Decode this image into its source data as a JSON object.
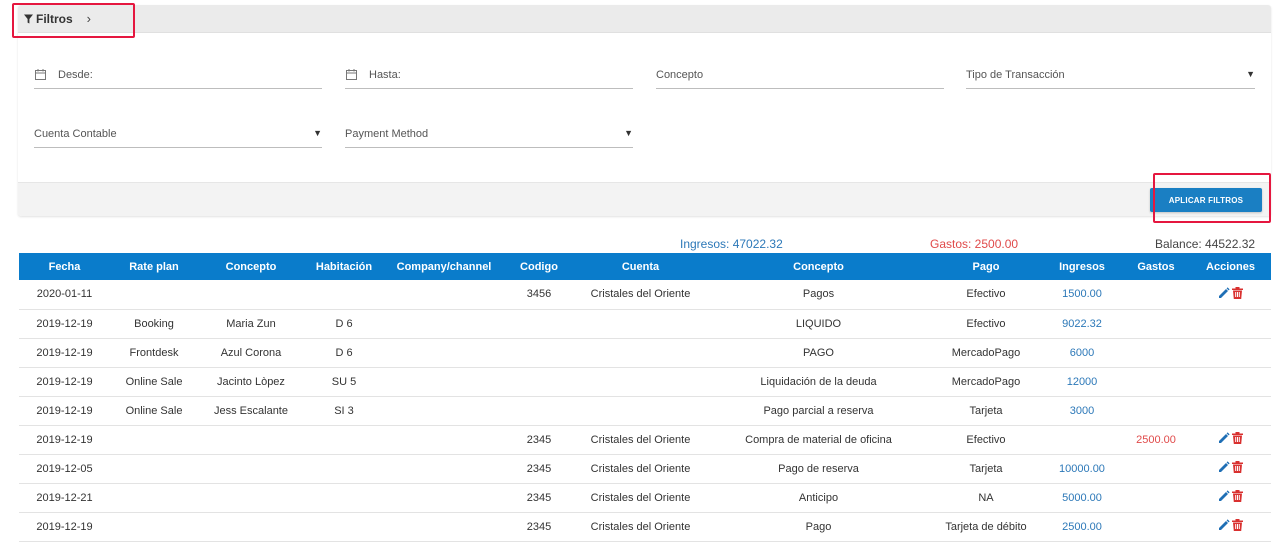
{
  "filters": {
    "title": "Filtros",
    "desde_label": "Desde:",
    "hasta_label": "Hasta:",
    "concepto_label": "Concepto",
    "tipo_transaccion_label": "Tipo de Transacción",
    "cuenta_contable_label": "Cuenta Contable",
    "payment_method_label": "Payment Method",
    "apply_button": "APLICAR FILTROS"
  },
  "totals": {
    "ingresos": "Ingresos: 47022.32",
    "gastos": "Gastos: 2500.00",
    "balance": "Balance: 44522.32"
  },
  "colors": {
    "header_blue": "#0a7ccb",
    "ingresos_blue": "#2c78b8",
    "gastos_red": "#e04a4a",
    "highlight_red": "#e5173f"
  },
  "table": {
    "columns": [
      "Fecha",
      "Rate plan",
      "Concepto",
      "Habitación",
      "Company/channel",
      "Codigo",
      "Cuenta",
      "Concepto",
      "Pago",
      "Ingresos",
      "Gastos",
      "Acciones"
    ],
    "rows": [
      {
        "fecha": "2020-01-11",
        "rate_plan": "",
        "concepto1": "",
        "habitacion": "",
        "company": "",
        "codigo": "3456",
        "cuenta": "Cristales del Oriente",
        "concepto2": "Pagos",
        "pago": "Efectivo",
        "ingresos": "1500.00",
        "gastos": "",
        "acciones": true
      },
      {
        "fecha": "2019-12-19",
        "rate_plan": "Booking",
        "concepto1": "Maria Zun",
        "habitacion": "D 6",
        "company": "",
        "codigo": "",
        "cuenta": "",
        "concepto2": "LIQUIDO",
        "pago": "Efectivo",
        "ingresos": "9022.32",
        "gastos": "",
        "acciones": false
      },
      {
        "fecha": "2019-12-19",
        "rate_plan": "Frontdesk",
        "concepto1": "Azul Corona",
        "habitacion": "D 6",
        "company": "",
        "codigo": "",
        "cuenta": "",
        "concepto2": "PAGO",
        "pago": "MercadoPago",
        "ingresos": "6000",
        "gastos": "",
        "acciones": false
      },
      {
        "fecha": "2019-12-19",
        "rate_plan": "Online Sale",
        "concepto1": "Jacinto Lòpez",
        "habitacion": "SU 5",
        "company": "",
        "codigo": "",
        "cuenta": "",
        "concepto2": "Liquidación de la deuda",
        "pago": "MercadoPago",
        "ingresos": "12000",
        "gastos": "",
        "acciones": false
      },
      {
        "fecha": "2019-12-19",
        "rate_plan": "Online Sale",
        "concepto1": "Jess Escalante",
        "habitacion": "SI 3",
        "company": "",
        "codigo": "",
        "cuenta": "",
        "concepto2": "Pago parcial a reserva",
        "pago": "Tarjeta",
        "ingresos": "3000",
        "gastos": "",
        "acciones": false
      },
      {
        "fecha": "2019-12-19",
        "rate_plan": "",
        "concepto1": "",
        "habitacion": "",
        "company": "",
        "codigo": "2345",
        "cuenta": "Cristales del Oriente",
        "concepto2": "Compra de material de oficina",
        "pago": "Efectivo",
        "ingresos": "",
        "gastos": "2500.00",
        "acciones": true
      },
      {
        "fecha": "2019-12-05",
        "rate_plan": "",
        "concepto1": "",
        "habitacion": "",
        "company": "",
        "codigo": "2345",
        "cuenta": "Cristales del Oriente",
        "concepto2": "Pago de reserva",
        "pago": "Tarjeta",
        "ingresos": "10000.00",
        "gastos": "",
        "acciones": true
      },
      {
        "fecha": "2019-12-21",
        "rate_plan": "",
        "concepto1": "",
        "habitacion": "",
        "company": "",
        "codigo": "2345",
        "cuenta": "Cristales del Oriente",
        "concepto2": "Anticipo",
        "pago": "NA",
        "ingresos": "5000.00",
        "gastos": "",
        "acciones": true
      },
      {
        "fecha": "2019-12-19",
        "rate_plan": "",
        "concepto1": "",
        "habitacion": "",
        "company": "",
        "codigo": "2345",
        "cuenta": "Cristales del Oriente",
        "concepto2": "Pago",
        "pago": "Tarjeta de débito",
        "ingresos": "2500.00",
        "gastos": "",
        "acciones": true
      }
    ]
  }
}
